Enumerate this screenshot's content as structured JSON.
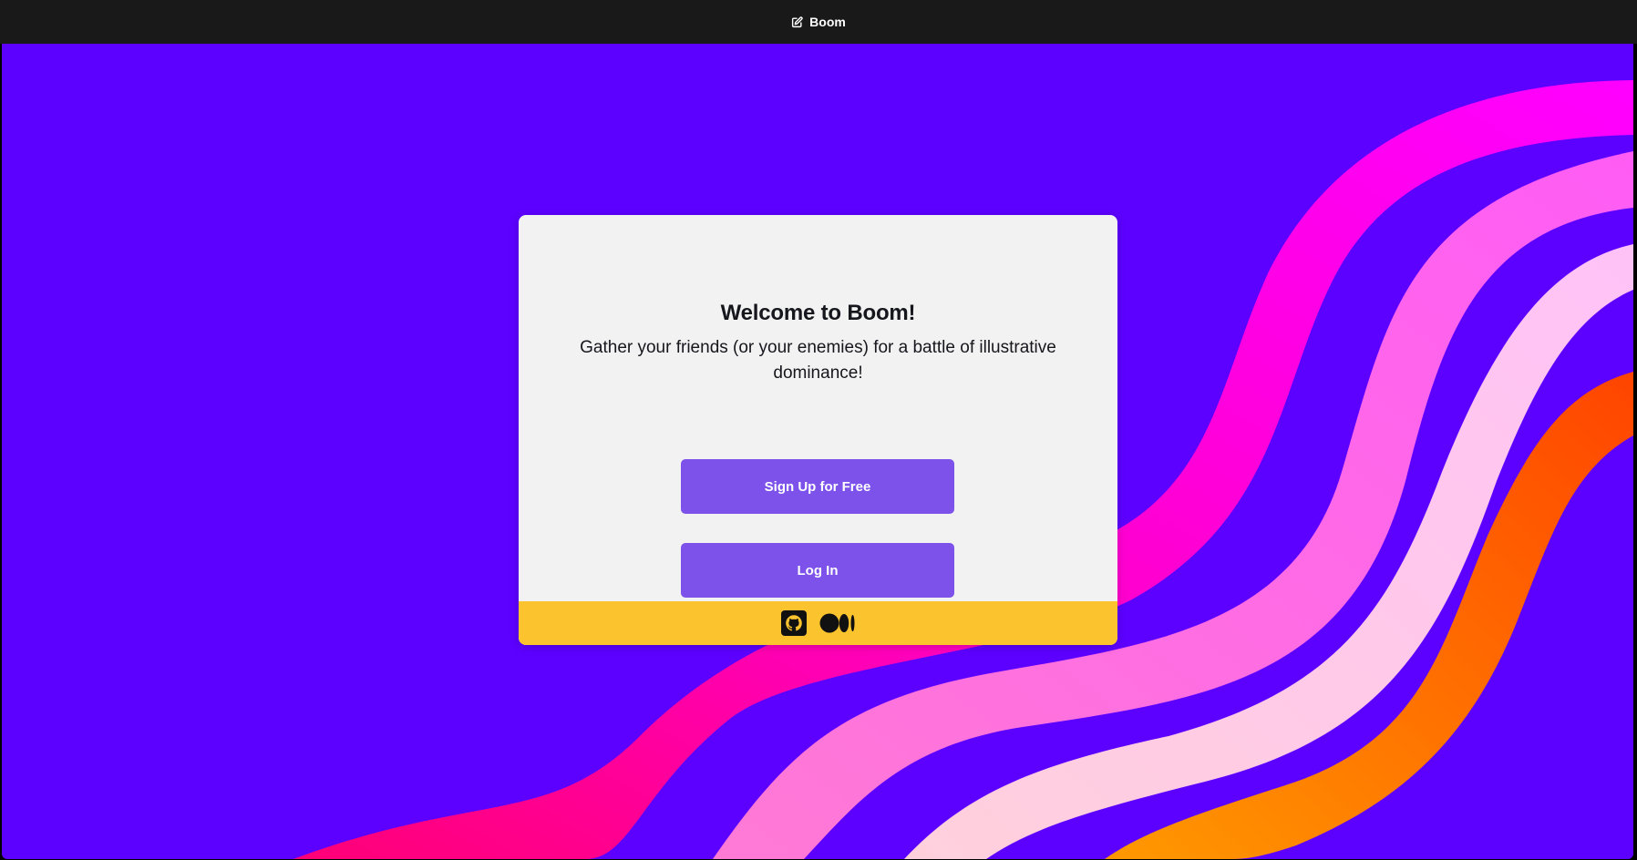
{
  "header": {
    "app_name": "Boom",
    "logo_icon": "edit-square-icon"
  },
  "card": {
    "title": "Welcome to Boom!",
    "subtitle": "Gather your friends (or your enemies) for a battle of illustrative dominance!",
    "signup_label": "Sign Up for Free",
    "login_label": "Log In"
  },
  "footer": {
    "icons": [
      "github-icon",
      "medium-icon"
    ]
  },
  "colors": {
    "topbar": "#191919",
    "background": "#5c00ff",
    "card": "#f2f2f2",
    "button": "#7c52ea",
    "footer": "#fbc32d",
    "text": "#16161d",
    "wave_magenta": "#ff00ea",
    "wave_hot_pink": "#ff0077",
    "wave_pink": "#ff66ee",
    "wave_light_pink": "#ffccdd",
    "wave_orange": "#ff6600"
  }
}
